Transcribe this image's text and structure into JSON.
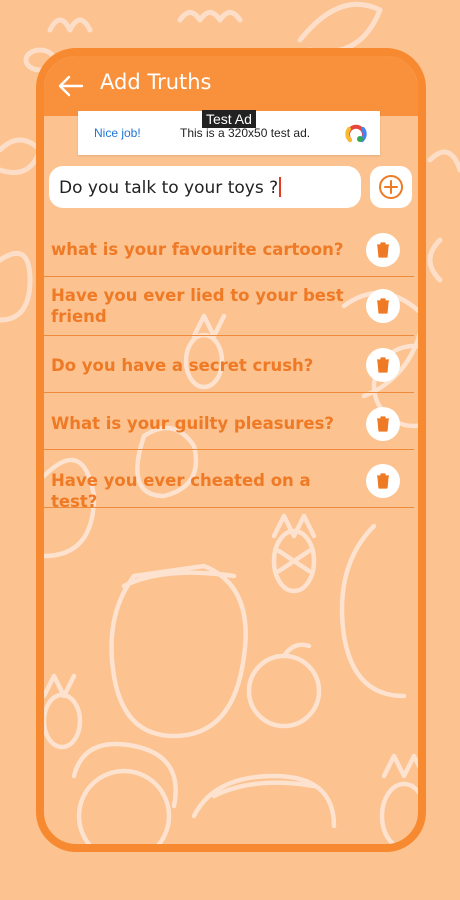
{
  "app": {
    "title": "Add Truths",
    "theme": {
      "accent": "#f9913c",
      "border": "#f78a30",
      "text_orange": "#ef7a26",
      "background": "#fcc28f"
    }
  },
  "ad": {
    "label": "Test Ad",
    "nice_job": "Nice job!",
    "text": "This is a 320x50 test ad."
  },
  "input": {
    "value": "Do you talk to your toys ?"
  },
  "truths": [
    {
      "text": "what is your favourite cartoon?"
    },
    {
      "text": "Have you ever lied to your best friend"
    },
    {
      "text": "Do you have a secret crush?"
    },
    {
      "text": "What is your guilty pleasures?"
    },
    {
      "text": "Have you ever cheated on a test?"
    }
  ],
  "icons": {
    "back": "arrow-left-icon",
    "add": "plus-circle-icon",
    "delete": "trash-icon"
  }
}
